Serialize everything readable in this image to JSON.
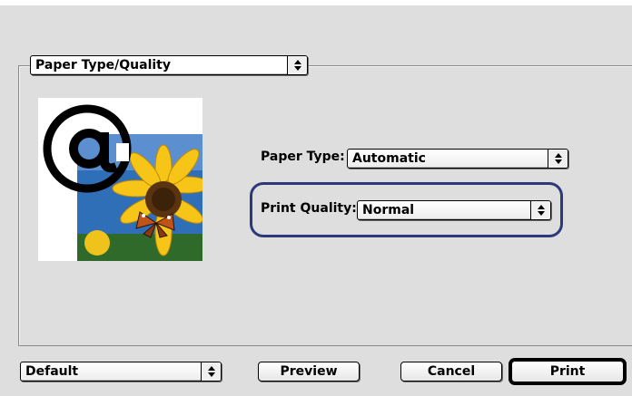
{
  "panel": {
    "selected": "Paper Type/Quality"
  },
  "paper_type": {
    "label": "Paper Type:",
    "value": "Automatic"
  },
  "print_quality": {
    "label": "Print Quality:",
    "value": "Normal",
    "highlight_color": "#2c3a7a"
  },
  "footer": {
    "preset_value": "Default",
    "preview_label": "Preview",
    "cancel_label": "Cancel",
    "print_label": "Print"
  },
  "preview_image": {
    "icon": "at-sign-icon",
    "subject": "sunflower-butterfly-photo"
  }
}
